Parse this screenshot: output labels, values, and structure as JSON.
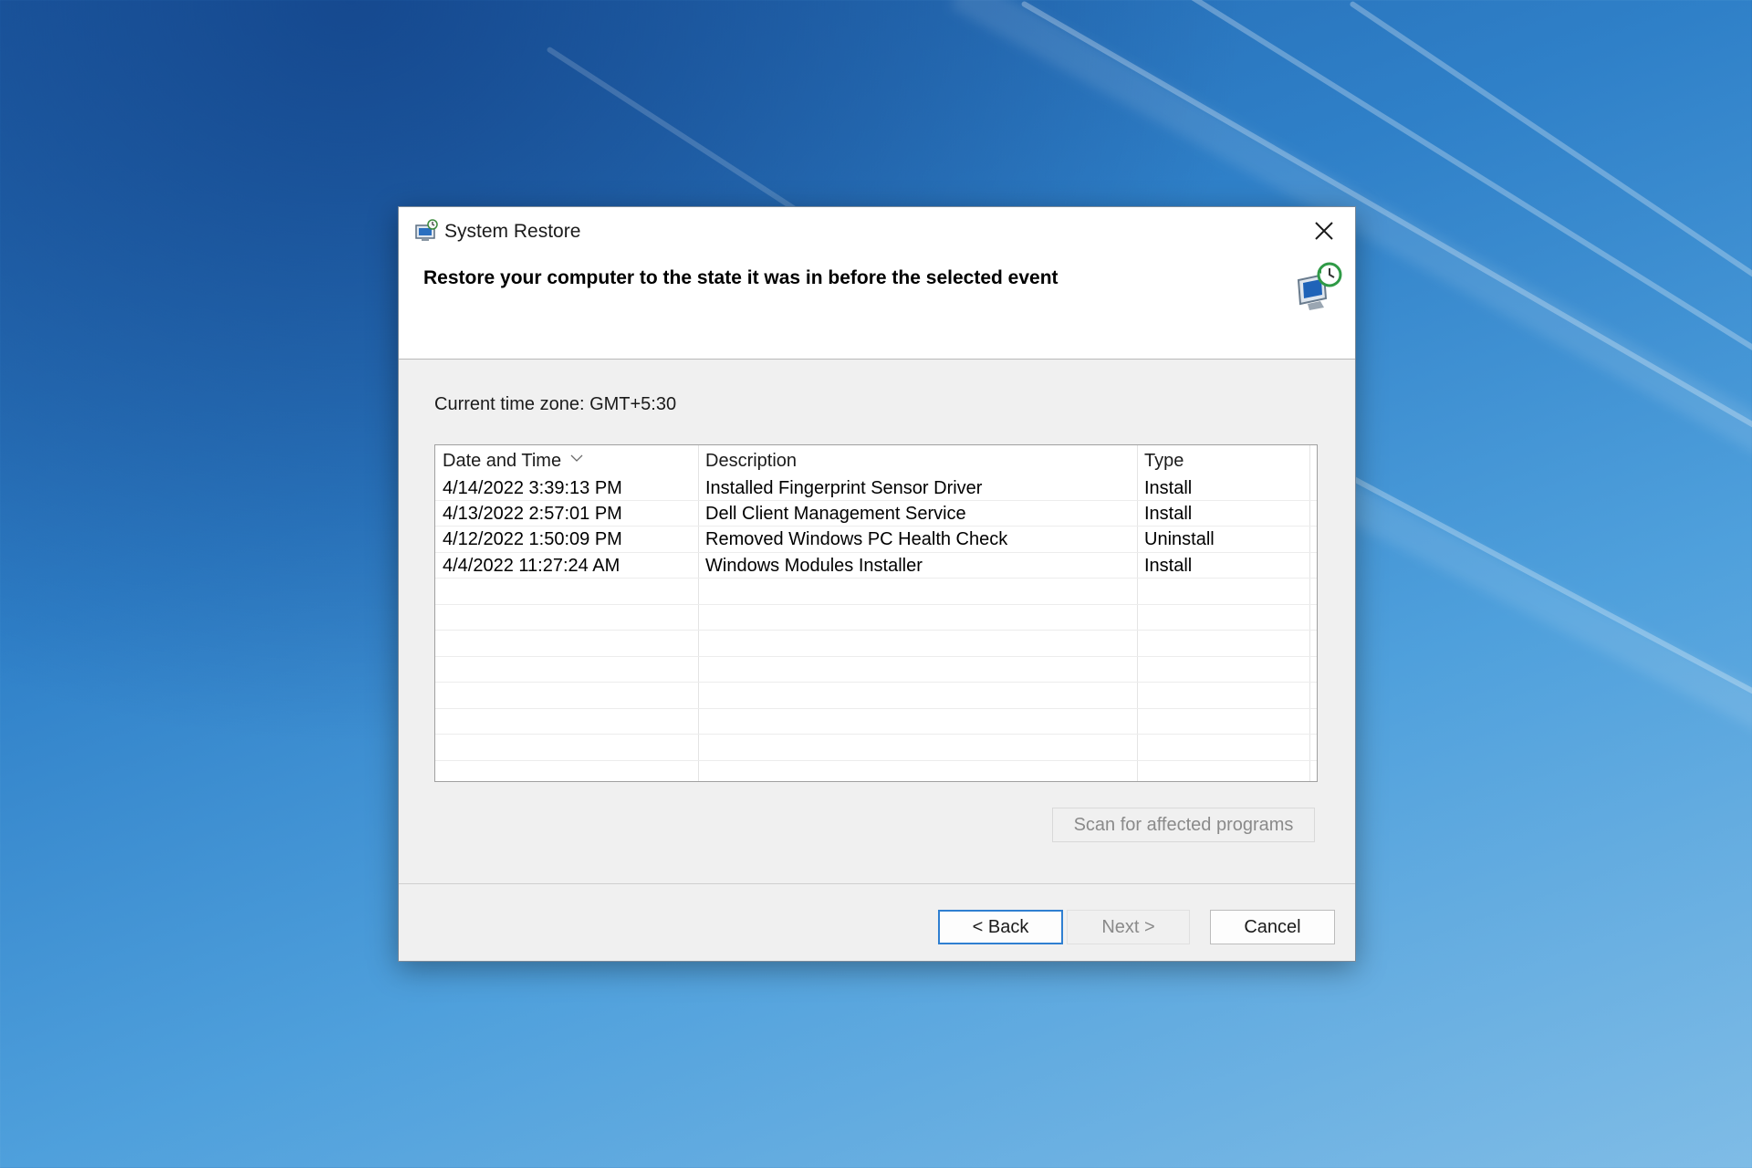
{
  "window": {
    "title": "System Restore",
    "heading": "Restore your computer to the state it was in before the selected event"
  },
  "timezone_text": "Current time zone: GMT+5:30",
  "table": {
    "columns": [
      "Date and Time",
      "Description",
      "Type"
    ],
    "sorted_column": "Date and Time",
    "rows": [
      {
        "date": "4/14/2022 3:39:13 PM",
        "description": "Installed Fingerprint Sensor Driver",
        "type": "Install"
      },
      {
        "date": "4/13/2022 2:57:01 PM",
        "description": "Dell Client Management Service",
        "type": "Install"
      },
      {
        "date": "4/12/2022 1:50:09 PM",
        "description": "Removed Windows PC Health Check",
        "type": "Uninstall"
      },
      {
        "date": "4/4/2022 11:27:24 AM",
        "description": "Windows Modules Installer",
        "type": "Install"
      }
    ]
  },
  "buttons": {
    "scan": "Scan for affected programs",
    "back": "< Back",
    "next": "Next >",
    "cancel": "Cancel"
  },
  "colors": {
    "accent": "#2f7fd1",
    "disabled_text": "#8a8a8a"
  },
  "icons": [
    "system-restore-icon",
    "close-icon",
    "system-restore-large-icon",
    "sort-chevron-icon"
  ]
}
